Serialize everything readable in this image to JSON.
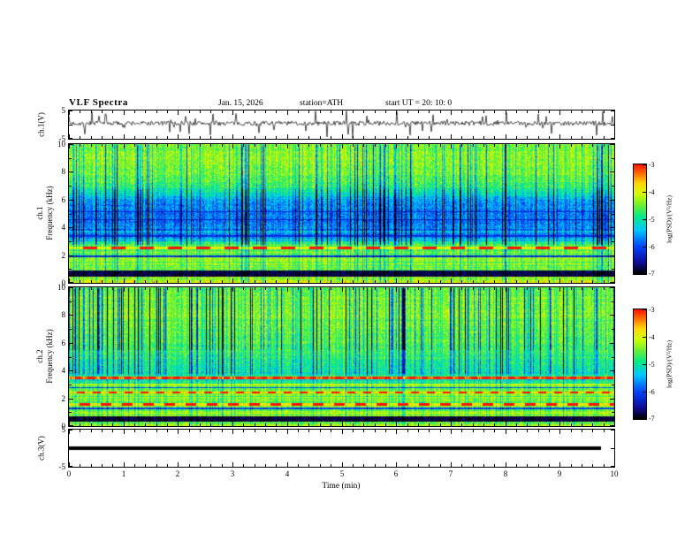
{
  "header": {
    "title": "VLF  Spectra",
    "date": "Jan. 15, 2026",
    "station": "station=ATH",
    "start_ut": "start UT =  20: 10: 0"
  },
  "x_axis": {
    "label": "Time  (min)",
    "min": 0,
    "max": 10,
    "major_ticks": [
      0,
      1,
      2,
      3,
      4,
      5,
      6,
      7,
      8,
      9,
      10
    ],
    "minor_step": 0.2
  },
  "colorbar": {
    "label": "log(PSD)/(V²/Hz)",
    "min": -7,
    "max": -3,
    "ticks": [
      -3,
      -4,
      -5,
      -6,
      -7
    ]
  },
  "chart_data": [
    {
      "id": "ch1_waveform",
      "type": "line",
      "ylabel": "ch.1(V)",
      "ylim": [
        -5,
        5
      ],
      "ytick_labels": [
        5,
        -5
      ],
      "signal": {
        "mean": 0.5,
        "noise": 0.8,
        "spike_prob": 0.09,
        "spike_max": 3.8,
        "seed": 7
      }
    },
    {
      "id": "ch1_spectrogram",
      "type": "heatmap",
      "ylabel_channel": "ch.1",
      "ylabel_axis": "Frequency (kHz)",
      "ylim": [
        0,
        10
      ],
      "ytick_labels": [
        0,
        2,
        4,
        6,
        8,
        10
      ],
      "value_range": [
        -7,
        -3
      ],
      "render": {
        "seed": 42,
        "noise": 0.85,
        "profile": [
          [
            0,
            -4.1
          ],
          [
            0.4,
            -4.2
          ],
          [
            1.0,
            -4.5
          ],
          [
            1.6,
            -4.3
          ],
          [
            2.2,
            -4.5
          ],
          [
            2.8,
            -4.8
          ],
          [
            3.2,
            -5.4
          ],
          [
            4.0,
            -5.7
          ],
          [
            5.0,
            -5.8
          ],
          [
            6.0,
            -5.5
          ],
          [
            6.6,
            -5.0
          ],
          [
            7.2,
            -4.6
          ],
          [
            8.0,
            -4.4
          ],
          [
            9.0,
            -4.3
          ],
          [
            10,
            -4.4
          ]
        ],
        "bands": [
          {
            "f": 0.7,
            "half_width": 0.22,
            "value": -6.8
          },
          {
            "f": 1.95,
            "half_width": 0.05,
            "value": -6.2
          },
          {
            "f": 2.55,
            "half_width": 0.07,
            "value": -3.9,
            "dash_period": 16
          },
          {
            "f": 3.4,
            "half_width": 0.05,
            "value": -6.2
          },
          {
            "f": 4.6,
            "half_width": 0.04,
            "value": -6.3
          },
          {
            "f": 5.15,
            "half_width": 0.04,
            "value": -6.2
          }
        ],
        "streaks": {
          "prob": 0.3,
          "max": 2.6,
          "zones": [
            [
              0,
              2.8,
              0.45
            ],
            [
              2.8,
              6.8,
              1.0
            ],
            [
              6.8,
              10,
              0.75
            ]
          ]
        }
      }
    },
    {
      "id": "ch2_spectrogram",
      "type": "heatmap",
      "ylabel_channel": "ch.2",
      "ylabel_axis": "Frequency (kHz)",
      "ylim": [
        0,
        10
      ],
      "ytick_labels": [
        0,
        2,
        4,
        6,
        8,
        10
      ],
      "value_range": [
        -7,
        -3
      ],
      "render": {
        "seed": 1234,
        "noise": 0.8,
        "profile": [
          [
            0,
            -4.4
          ],
          [
            0.3,
            -4.3
          ],
          [
            0.9,
            -4.5
          ],
          [
            1.4,
            -4.4
          ],
          [
            2.0,
            -4.5
          ],
          [
            2.9,
            -4.4
          ],
          [
            3.2,
            -4.9
          ],
          [
            3.8,
            -5.0
          ],
          [
            4.5,
            -4.9
          ],
          [
            5.2,
            -4.7
          ],
          [
            6.0,
            -4.6
          ],
          [
            7.0,
            -4.5
          ],
          [
            8.0,
            -4.4
          ],
          [
            9.0,
            -4.4
          ],
          [
            10,
            -4.5
          ]
        ],
        "bands": [
          {
            "f": 0.55,
            "half_width": 0.18,
            "value": -6.8
          },
          {
            "f": 0.95,
            "half_width": 0.05,
            "value": -4.0
          },
          {
            "f": 1.3,
            "half_width": 0.05,
            "value": -6.0
          },
          {
            "f": 1.6,
            "half_width": 0.08,
            "value": -3.8,
            "dash_period": 12
          },
          {
            "f": 2.1,
            "half_width": 0.06,
            "value": -4.1
          },
          {
            "f": 2.45,
            "half_width": 0.08,
            "value": -3.7,
            "dash_period": 9
          },
          {
            "f": 2.8,
            "half_width": 0.05,
            "value": -5.9
          },
          {
            "f": 3.05,
            "half_width": 0.06,
            "value": -4.0
          },
          {
            "f": 3.5,
            "half_width": 0.12,
            "value": -3.2,
            "dash_period": 7
          }
        ],
        "streaks": {
          "prob": 0.34,
          "max": 2.8,
          "zones": [
            [
              0,
              3.8,
              0.3
            ],
            [
              3.8,
              5.5,
              0.7
            ],
            [
              5.5,
              10,
              1.15
            ]
          ]
        }
      }
    },
    {
      "id": "ch3_waveform",
      "type": "flat",
      "ylabel": "ch.3(V)",
      "ylim": [
        -5,
        5
      ],
      "ytick_labels": [
        5,
        -5
      ],
      "value": 0,
      "x_extent": 9.75,
      "line_width": 4
    }
  ]
}
